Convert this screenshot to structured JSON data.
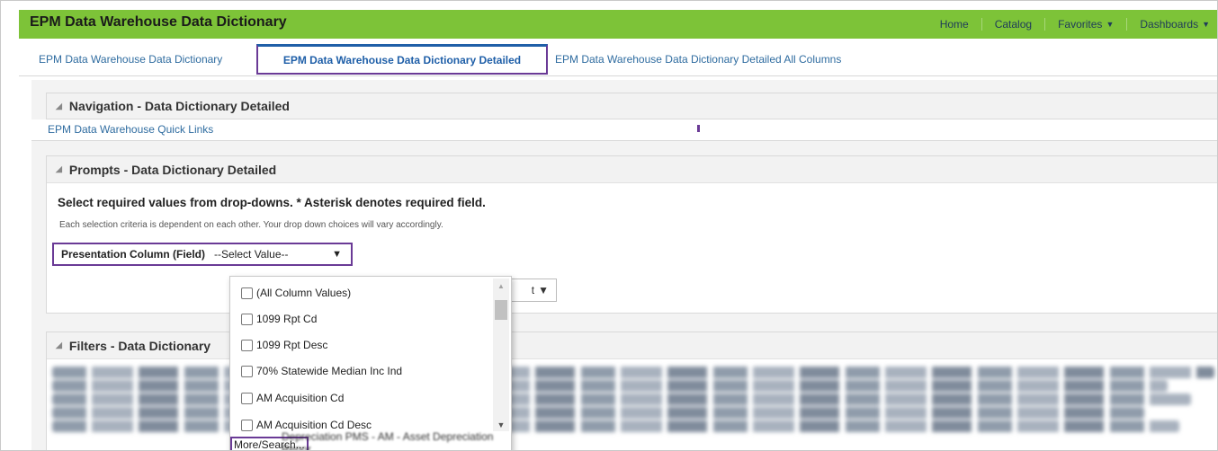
{
  "app": {
    "title": "EPM Data Warehouse Data Dictionary"
  },
  "topnav": {
    "home": "Home",
    "catalog": "Catalog",
    "favorites": "Favorites",
    "dashboards": "Dashboards"
  },
  "tabs": [
    {
      "label": "EPM Data Warehouse Data Dictionary"
    },
    {
      "label": "EPM Data Warehouse Data Dictionary Detailed"
    },
    {
      "label": "EPM Data Warehouse Data Dictionary Detailed All Columns"
    }
  ],
  "navigation": {
    "header": "Navigation - Data Dictionary Detailed",
    "link": "EPM Data Warehouse Quick Links"
  },
  "prompts": {
    "header": "Prompts - Data Dictionary Detailed",
    "title": "Select required values from drop-downs. * Asterisk denotes required field.",
    "note": "Each selection criteria is dependent on each other.  Your drop down choices will vary accordingly.",
    "field_label": "Presentation Column (Field)",
    "field_value": "--Select Value--"
  },
  "filters": {
    "header": "Filters - Data Dictionary"
  },
  "dropdown": {
    "items": [
      "(All Column Values)",
      "1099 Rpt Cd",
      "1099 Rpt Desc",
      "70% Statewide Median Inc Ind",
      "AM Acquisition Cd",
      "AM Acquisition Cd Desc"
    ],
    "more": "More/Search..."
  },
  "background_text": "Depreciation PMS - AM - Asset Depreciation Repor"
}
